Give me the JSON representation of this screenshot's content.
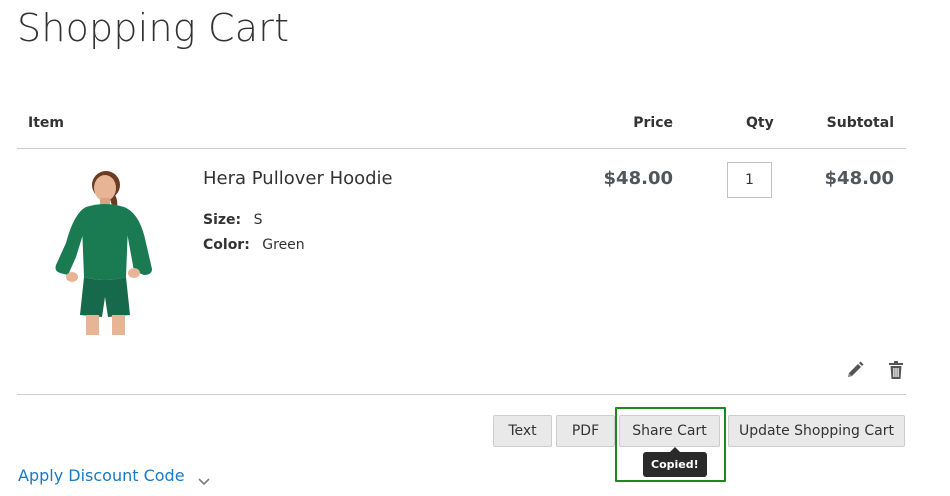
{
  "page": {
    "title": "Shopping Cart"
  },
  "table": {
    "headers": {
      "item": "Item",
      "price": "Price",
      "qty": "Qty",
      "subtotal": "Subtotal"
    }
  },
  "cart_items": [
    {
      "name": "Hera Pullover Hoodie",
      "image_alt": "Hera Pullover Hoodie",
      "options": [
        {
          "label": "Size:",
          "value": "S"
        },
        {
          "label": "Color:",
          "value": "Green"
        }
      ],
      "price": "$48.00",
      "qty": "1",
      "subtotal": "$48.00",
      "actions": {
        "edit_icon": "pencil-icon",
        "delete_icon": "trash-icon"
      }
    }
  ],
  "buttons": {
    "text": "Text",
    "pdf": "PDF",
    "share_cart": "Share Cart",
    "update_cart": "Update Shopping Cart"
  },
  "tooltip": {
    "text": "Copied!"
  },
  "discount": {
    "label": "Apply Discount Code",
    "icon": "chevron-down-icon"
  },
  "colors": {
    "link": "#1979c3",
    "button_bg": "#e9e9e9",
    "highlight": "#1a8a1a",
    "tooltip_bg": "#2a2a2a",
    "product_green": "#1a7a52"
  }
}
